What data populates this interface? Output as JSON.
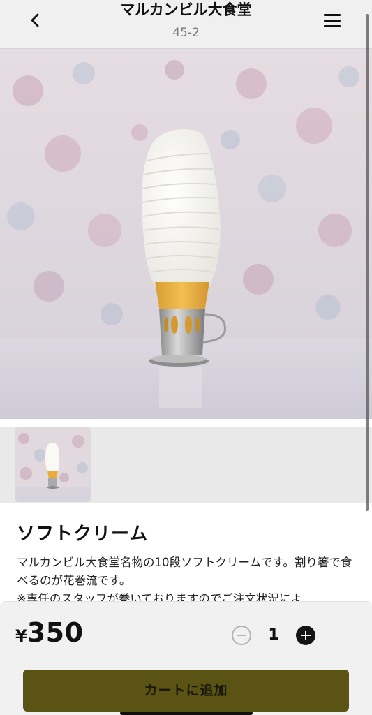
{
  "header": {
    "title": "マルカンビル大食堂",
    "subtitle": "45-2",
    "back_icon": "chevron-left-icon",
    "menu_icon": "hamburger-menu-icon"
  },
  "product": {
    "name": "ソフトクリーム",
    "description": "マルカンビル大食堂名物の10段ソフトクリームです。割り箸で食べるのが花巻流です。\n※専任のスタッフが巻いておりますのでご注文状況によ"
  },
  "price": {
    "currency": "¥",
    "amount": "350"
  },
  "quantity": {
    "value": "1",
    "minus_icon": "minus-circle-icon",
    "plus_icon": "plus-circle-icon"
  },
  "cart": {
    "label": "カートに追加"
  },
  "colors": {
    "accent": "#5b5314",
    "header_bg": "#f0f0f0",
    "bottom_bar_bg": "#f1f1f1"
  }
}
